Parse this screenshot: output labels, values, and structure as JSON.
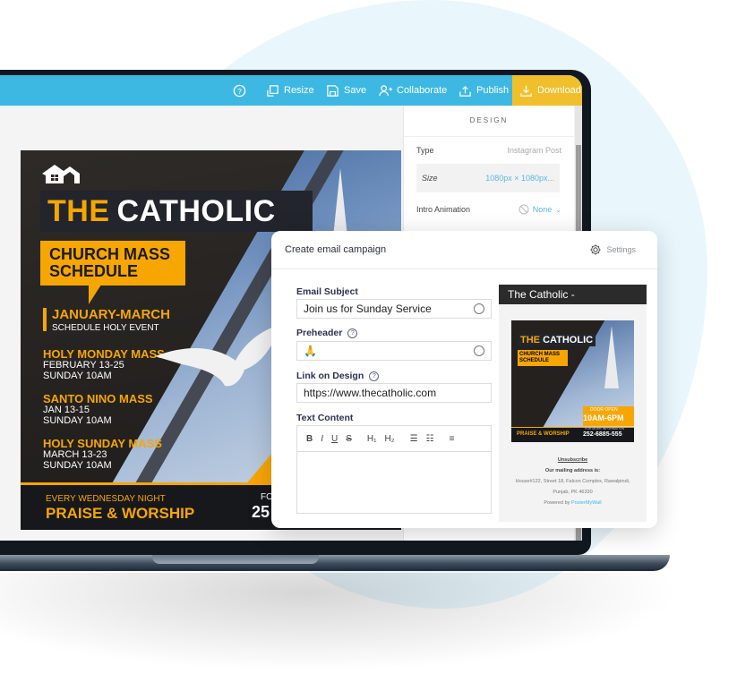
{
  "toolbar": {
    "help_icon": "question-circle-icon",
    "items": [
      {
        "label": "Resize",
        "icon": "resize-icon"
      },
      {
        "label": "Save",
        "icon": "save-icon"
      },
      {
        "label": "Collaborate",
        "icon": "add-user-icon"
      },
      {
        "label": "Publish",
        "icon": "upload-icon"
      },
      {
        "label": "Download",
        "icon": "download-icon"
      }
    ],
    "colors": {
      "bar": "#3db8e3",
      "download": "#f2bf2c"
    }
  },
  "design_panel": {
    "title": "DESIGN",
    "type_label": "Type",
    "type_value": "Instagram Post",
    "size_label": "Size",
    "size_value": "1080px × 1080px...",
    "animation_label": "Intro Animation",
    "animation_value": "None"
  },
  "poster": {
    "title_yellow": "THE",
    "title_white": "CATHOLIC",
    "subtitle_line1": "CHURCH MASS",
    "subtitle_line2": "SCHEDULE",
    "period": "JANUARY-MARCH",
    "period_sub": "SCHEDULE HOLY EVENT",
    "masses": [
      {
        "name": "HOLY MONDAY MASS",
        "date": "FEBRUARY 13-25",
        "time": "SUNDAY 10AM"
      },
      {
        "name": "SANTO NINO MASS",
        "date": "JAN 13-15",
        "time": "SUNDAY 10AM"
      },
      {
        "name": "HOLY SUNDAY MASS",
        "date": "MARCH 13-23",
        "time": "SUNDAY 10AM"
      }
    ],
    "footer_small": "EVERY WEDNESDAY NIGHT",
    "footer_big": "PRAISE & WORSHIP",
    "hours_partial": "10",
    "info_partial": "FO",
    "phone_partial": "25",
    "accent": "#f7a600"
  },
  "email_modal": {
    "title": "Create email campaign",
    "settings_label": "Settings",
    "subject_label": "Email Subject",
    "subject_value": "Join us for Sunday Service",
    "preheader_label": "Preheader",
    "preheader_value": "🙏",
    "link_label": "Link on Design",
    "link_value": "https://www.thecatholic.com",
    "text_content_label": "Text Content",
    "editor_tools": [
      "B",
      "I",
      "U",
      "S",
      "H1",
      "H2",
      "ordered-list",
      "bullet-list",
      "align"
    ],
    "editor_tool_glyphs": [
      "B",
      "I",
      "U",
      "S",
      "H₁",
      "H₂",
      "☰",
      "☷",
      "≡"
    ]
  },
  "email_preview": {
    "header": "The Catholic -",
    "door_open": "DOOR OPEN",
    "hours": "10AM-6PM",
    "more_info": "FOR MORE INFORMATION",
    "phone": "252-6885-555",
    "unsubscribe": "Unsubscribe",
    "address_heading": "Our mailing address is:",
    "address_line1": "House#122, Street 18, Falcon Complex, Rawalpindi,",
    "address_line2": "Punjab, PK 46330",
    "powered_by": "Powered by",
    "powered_brand": "PosterMyWall"
  }
}
